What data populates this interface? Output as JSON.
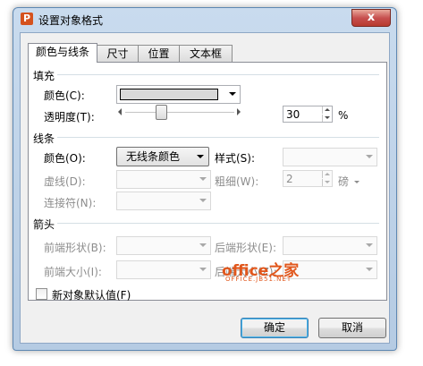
{
  "window": {
    "app_icon": "P",
    "title": "设置对象格式",
    "close_label": "x"
  },
  "tabs": [
    {
      "label": "颜色与线条",
      "active": true
    },
    {
      "label": "尺寸",
      "active": false
    },
    {
      "label": "位置",
      "active": false
    },
    {
      "label": "文本框",
      "active": false
    }
  ],
  "fill": {
    "header": "填充",
    "color_label": "颜色(C):",
    "color_value_hex": "#d9d9d9",
    "transparency_label": "透明度(T):",
    "transparency_value": "30",
    "transparency_unit": "%"
  },
  "line": {
    "header": "线条",
    "color_label": "颜色(O):",
    "color_value": "无线条颜色",
    "style_label": "样式(S):",
    "dash_label": "虚线(D):",
    "weight_label": "粗细(W):",
    "weight_value": "2",
    "weight_unit": "磅",
    "connector_label": "连接符(N):"
  },
  "arrows": {
    "header": "箭头",
    "begin_style_label": "前端形状(B):",
    "end_style_label": "后端形状(E):",
    "begin_size_label": "前端大小(I):",
    "end_size_label": "后端大小(Z):"
  },
  "default_checkbox_label": "新对象默认值(F)",
  "buttons": {
    "ok": "确定",
    "cancel": "取消"
  },
  "watermark": {
    "main": "office之家",
    "sub": "OFFICE.JB51.NET"
  },
  "colors": {
    "accent": "#3c7fb1",
    "close": "#c75050",
    "watermark": "#e1571c"
  }
}
